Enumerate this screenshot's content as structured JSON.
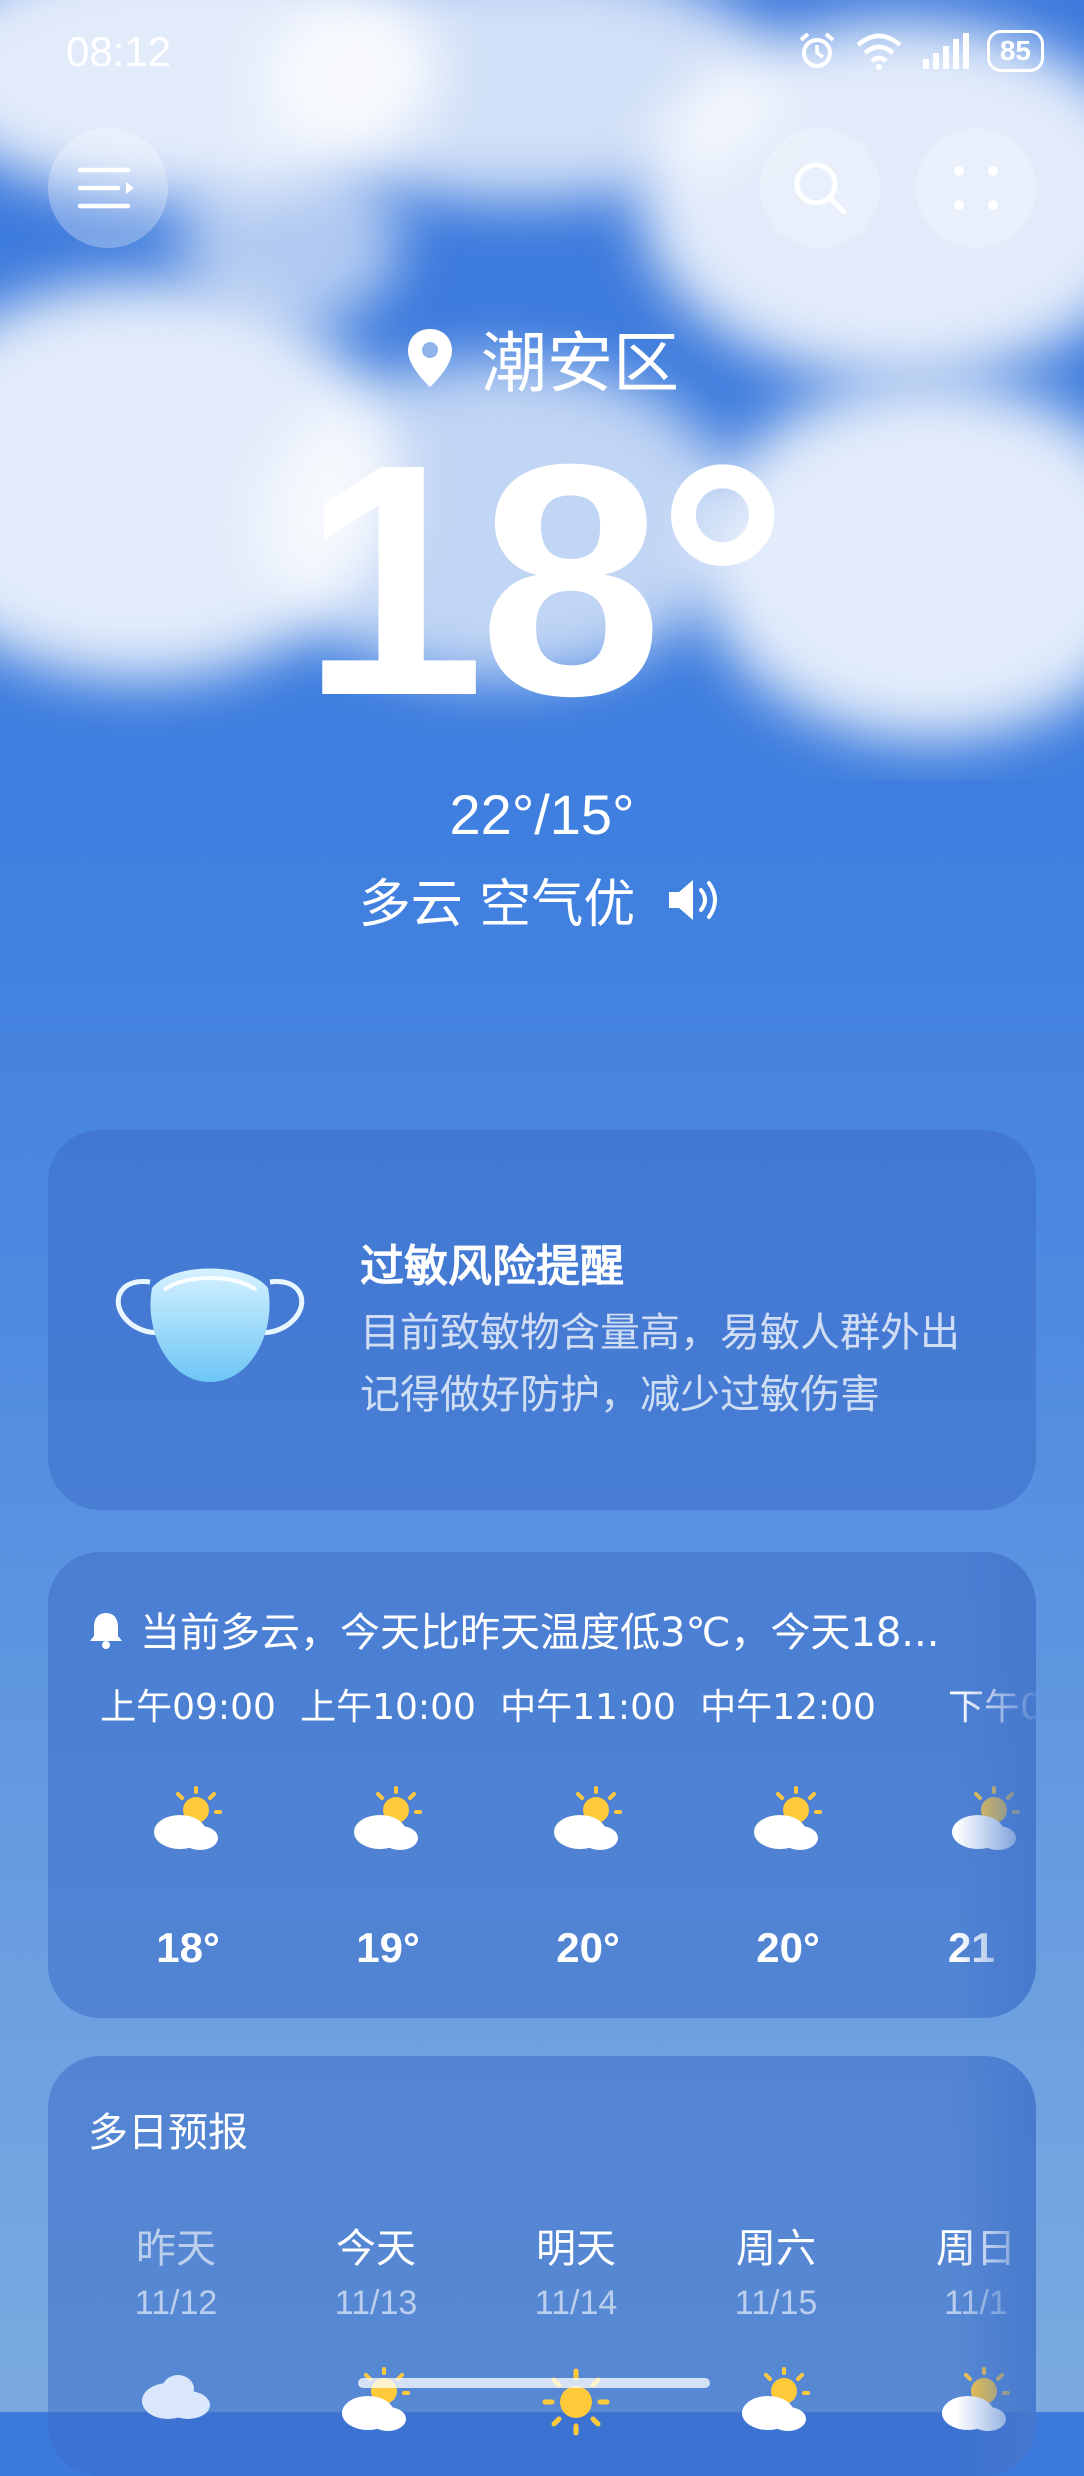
{
  "status_bar": {
    "time": "08:12",
    "battery": "85"
  },
  "location": {
    "name": "潮安区"
  },
  "current": {
    "temperature": "18°",
    "hilo": "22°/15°",
    "condition": "多云 空气优"
  },
  "allergy": {
    "title": "过敏风险提醒",
    "line1": "目前致敏物含量高，易敏人群外出",
    "line2": "记得做好防护，减少过敏伤害"
  },
  "hourly": {
    "summary": "当前多云，今天比昨天温度低3℃，今天18...",
    "items": [
      {
        "time": "上午09:00",
        "temp": "18°",
        "icon": "partly-cloudy-icon"
      },
      {
        "time": "上午10:00",
        "temp": "19°",
        "icon": "partly-cloudy-icon"
      },
      {
        "time": "中午11:00",
        "temp": "20°",
        "icon": "partly-cloudy-icon"
      },
      {
        "time": "中午12:00",
        "temp": "20°",
        "icon": "partly-cloudy-icon"
      },
      {
        "time": "下午0",
        "temp": "21",
        "icon": "partly-cloudy-icon"
      }
    ]
  },
  "daily": {
    "title": "多日预报",
    "items": [
      {
        "day": "昨天",
        "date": "11/12",
        "icon": "cloud-icon"
      },
      {
        "day": "今天",
        "date": "11/13",
        "icon": "partly-cloudy-icon"
      },
      {
        "day": "明天",
        "date": "11/14",
        "icon": "sun-icon"
      },
      {
        "day": "周六",
        "date": "11/15",
        "icon": "partly-cloudy-icon"
      },
      {
        "day": "周日",
        "date": "11/1",
        "icon": "partly-cloudy-icon"
      }
    ]
  },
  "colors": {
    "sun": "#ffc93c",
    "card": "#3c6ec8",
    "sky": "#3f7fdf"
  }
}
